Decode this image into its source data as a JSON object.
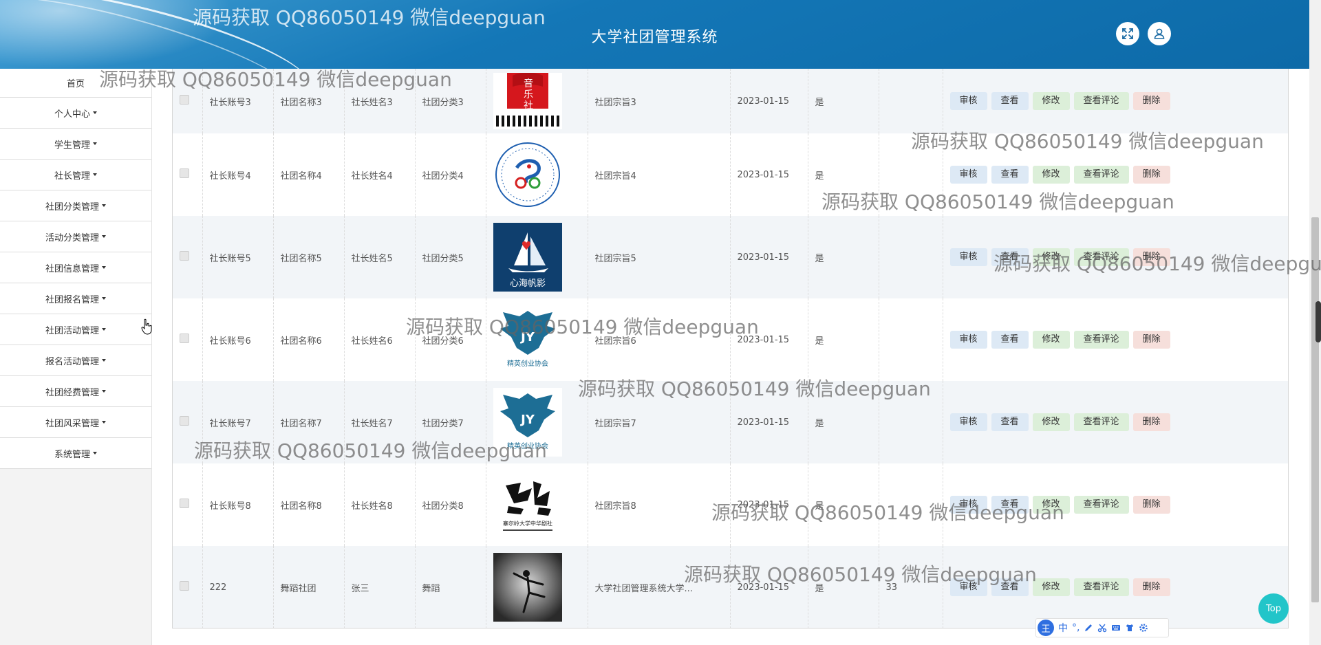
{
  "app": {
    "title": "大学社团管理系统"
  },
  "header": {
    "fullscreen_icon": "fullscreen-icon",
    "user_icon": "user-icon"
  },
  "sidebar": {
    "items": [
      {
        "label": "首页",
        "has_caret": false
      },
      {
        "label": "个人中心",
        "has_caret": true
      },
      {
        "label": "学生管理",
        "has_caret": true
      },
      {
        "label": "社长管理",
        "has_caret": true
      },
      {
        "label": "社团分类管理",
        "has_caret": true
      },
      {
        "label": "活动分类管理",
        "has_caret": true
      },
      {
        "label": "社团信息管理",
        "has_caret": true
      },
      {
        "label": "社团报名管理",
        "has_caret": true
      },
      {
        "label": "社团活动管理",
        "has_caret": true
      },
      {
        "label": "报名活动管理",
        "has_caret": true
      },
      {
        "label": "社团经费管理",
        "has_caret": true
      },
      {
        "label": "社团风采管理",
        "has_caret": true
      },
      {
        "label": "系统管理",
        "has_caret": true
      }
    ]
  },
  "table": {
    "rows": [
      {
        "account": "社长账号3",
        "club_name": "社团名称3",
        "leader_name": "社长姓名3",
        "category": "社团分类3",
        "logo": "music-club-logo",
        "tenet": "社团宗旨3",
        "date": "2023-01-15",
        "approved": "是",
        "reply": ""
      },
      {
        "account": "社长账号4",
        "club_name": "社团名称4",
        "leader_name": "社长姓名4",
        "category": "社团分类4",
        "logo": "cycling-club-logo",
        "tenet": "社团宗旨4",
        "date": "2023-01-15",
        "approved": "是",
        "reply": ""
      },
      {
        "account": "社长账号5",
        "club_name": "社团名称5",
        "leader_name": "社长姓名5",
        "category": "社团分类5",
        "logo": "sailboat-logo",
        "tenet": "社团宗旨5",
        "date": "2023-01-15",
        "approved": "是",
        "reply": ""
      },
      {
        "account": "社长账号6",
        "club_name": "社团名称6",
        "leader_name": "社长姓名6",
        "category": "社团分类6",
        "logo": "eagle-jy-logo",
        "tenet": "社团宗旨6",
        "date": "2023-01-15",
        "approved": "是",
        "reply": ""
      },
      {
        "account": "社长账号7",
        "club_name": "社团名称7",
        "leader_name": "社长姓名7",
        "category": "社团分类7",
        "logo": "eagle-jy-logo",
        "tenet": "社团宗旨7",
        "date": "2023-01-15",
        "approved": "是",
        "reply": ""
      },
      {
        "account": "社长账号8",
        "club_name": "社团名称8",
        "leader_name": "社长姓名8",
        "category": "社团分类8",
        "logo": "calligraphy-logo",
        "tenet": "社团宗旨8",
        "date": "2023-01-15",
        "approved": "是",
        "reply": ""
      },
      {
        "account": "222",
        "club_name": "舞蹈社团",
        "leader_name": "张三",
        "category": "舞蹈",
        "logo": "dancer-photo",
        "tenet": "大学社团管理系统大学...",
        "date": "2023-01-15",
        "approved": "是",
        "reply": "33"
      }
    ],
    "actions": {
      "audit": "审核",
      "view": "查看",
      "edit": "修改",
      "comments": "查看评论",
      "delete": "删除"
    }
  },
  "logo_texts": {
    "music_top": "音",
    "music_mid": "乐",
    "music_bottom": "社",
    "sail": "心海帆影",
    "jy": "JY",
    "elite": "精英创业协会",
    "calligraphy_small": "寨尔岭大学中华剧社"
  },
  "watermark": "源码获取 QQ86050149 微信deepguan",
  "top_button": "Top",
  "ime": {
    "logo": "王",
    "mode": "中",
    "punct": "°,",
    "icons": [
      "pen-icon",
      "scissors-icon",
      "keyboard-icon",
      "shirt-icon",
      "gear-icon"
    ]
  },
  "colors": {
    "header": "#0d6aa8",
    "top_button": "#22c5c9",
    "audit_btn": "#dde9f5",
    "edit_btn": "#dcefd9",
    "delete_btn": "#f6dfdb"
  }
}
